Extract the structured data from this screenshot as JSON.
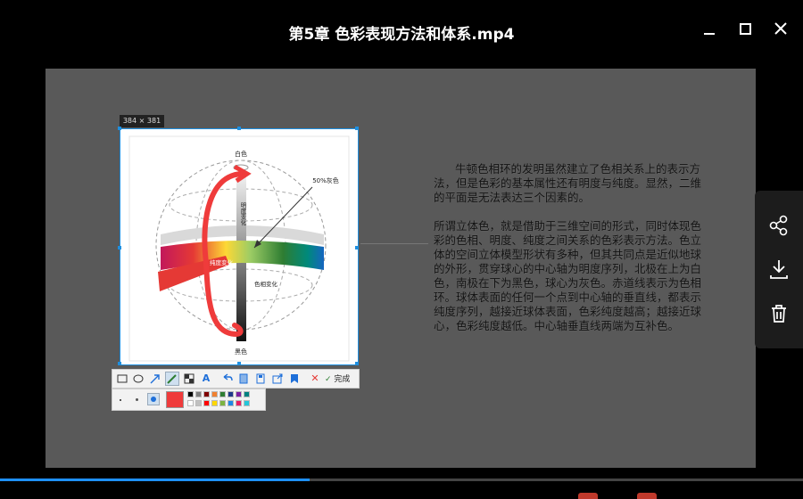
{
  "window": {
    "title": "第5章 色彩表现方法和体系.mp4"
  },
  "capture": {
    "size_label": "384 × 381"
  },
  "figure": {
    "white_label": "白色",
    "gray_label": "50%灰色",
    "lightness_label": "明度变化",
    "saturation_label": "纯度变化",
    "hue_label": "色相变化",
    "black_label": "黑色"
  },
  "slide": {
    "paragraph1": "牛顿色相环的发明虽然建立了色相关系上的表示方法，但是色彩的基本属性还有明度与纯度。显然，二维的平面是无法表达三个因素的。",
    "paragraph2": "所谓立体色，就是借助于三维空间的形式，同时体现色彩的色相、明度、纯度之间关系的色彩表示方法。色立体的空间立体模型形状有多种，但其共同点是近似地球的外形，贯穿球心的中心轴为明度序列，北极在上为白色，南极在下为黑色，球心为灰色。赤道线表示为色相环。球体表面的任何一个点到中心轴的垂直线，都表示纯度序列，越接近球体表面，色彩纯度越高；越接近球心，色彩纯度越低。中心轴垂直线两端为互补色。"
  },
  "toolbar": {
    "done_label": "完成",
    "tools": [
      "rectangle-tool",
      "ellipse-tool",
      "arrow-tool",
      "pen-tool",
      "mosaic-tool",
      "text-tool",
      "undo",
      "copy",
      "save",
      "share",
      "pin"
    ]
  },
  "palette": {
    "selected_color": "#ef3b3b",
    "colors": [
      "#000000",
      "#808080",
      "#800000",
      "#f08030",
      "#2e7d32",
      "#1e3a8a",
      "#7b1fa2",
      "#008080",
      "#ffffff",
      "#c0c0c0",
      "#ff0000",
      "#ffd700",
      "#7cb342",
      "#1e88e5",
      "#e91e63",
      "#26c6da"
    ]
  },
  "side_panel": {
    "actions": [
      "share",
      "download",
      "delete"
    ]
  },
  "player": {
    "progress": 0.385
  },
  "colors": {
    "accent": "#1e90ff",
    "annotation": "#ef3b3b"
  }
}
